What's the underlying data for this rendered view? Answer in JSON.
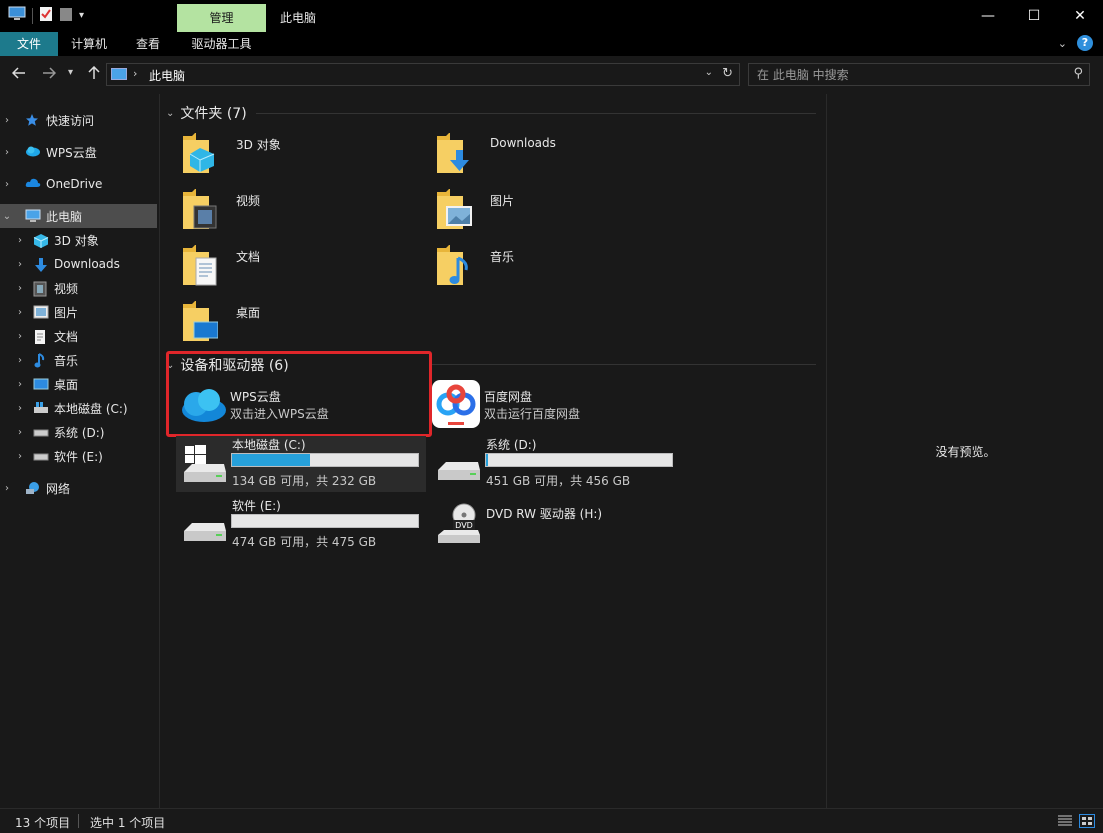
{
  "window": {
    "title": "此电脑",
    "context_tab": "管理",
    "minimize_glyph": "—",
    "maximize_glyph": "☐",
    "close_glyph": "✕"
  },
  "ribbon": {
    "tabs": [
      "文件",
      "计算机",
      "查看",
      "驱动器工具"
    ],
    "expand_glyph": "⌄",
    "help_glyph": "?"
  },
  "address": {
    "path": "此电脑",
    "search_placeholder": "在 此电脑 中搜索"
  },
  "sidebar": {
    "items": [
      {
        "label": "快速访问",
        "icon": "star-icon"
      },
      {
        "label": "WPS云盘",
        "icon": "wps-cloud-icon"
      },
      {
        "label": "OneDrive",
        "icon": "onedrive-cloud-icon"
      },
      {
        "label": "此电脑",
        "icon": "computer-icon",
        "selected": true
      },
      {
        "label": "3D 对象",
        "icon": "cube-icon"
      },
      {
        "label": "Downloads",
        "icon": "download-arrow-icon"
      },
      {
        "label": "视频",
        "icon": "video-icon"
      },
      {
        "label": "图片",
        "icon": "picture-icon"
      },
      {
        "label": "文档",
        "icon": "document-icon"
      },
      {
        "label": "音乐",
        "icon": "music-note-icon"
      },
      {
        "label": "桌面",
        "icon": "desktop-icon"
      },
      {
        "label": "本地磁盘 (C:)",
        "icon": "windows-drive-icon"
      },
      {
        "label": "系统 (D:)",
        "icon": "drive-icon"
      },
      {
        "label": "软件 (E:)",
        "icon": "drive-icon"
      },
      {
        "label": "网络",
        "icon": "network-icon"
      }
    ]
  },
  "folders_section": {
    "title": "文件夹 (7)",
    "items": [
      {
        "label": "3D 对象",
        "icon": "folder-3d-icon"
      },
      {
        "label": "Downloads",
        "icon": "folder-downloads-icon"
      },
      {
        "label": "视频",
        "icon": "folder-video-icon"
      },
      {
        "label": "图片",
        "icon": "folder-pictures-icon"
      },
      {
        "label": "文档",
        "icon": "folder-documents-icon"
      },
      {
        "label": "音乐",
        "icon": "folder-music-icon"
      },
      {
        "label": "桌面",
        "icon": "folder-desktop-icon"
      }
    ]
  },
  "devices_section": {
    "title": "设备和驱动器 (6)",
    "wps": {
      "name": "WPS云盘",
      "desc": "双击进入WPS云盘"
    },
    "baidu": {
      "name": "百度网盘",
      "desc": "双击运行百度网盘"
    },
    "drives": [
      {
        "name": "本地磁盘 (C:)",
        "info": "134 GB 可用，共 232 GB",
        "used_fraction": 0.42
      },
      {
        "name": "系统 (D:)",
        "info": "451 GB 可用，共 456 GB",
        "used_fraction": 0.01
      },
      {
        "name": "软件 (E:)",
        "info": "474 GB 可用，共 475 GB",
        "used_fraction": 0.0
      },
      {
        "name": "DVD RW 驱动器 (H:)",
        "info": ""
      }
    ],
    "dvd_badge": "DVD"
  },
  "preview": {
    "message": "没有预览。"
  },
  "status": {
    "count": "13 个项目",
    "selected": "选中 1 个项目"
  },
  "colors": {
    "accent": "#1d7a8c",
    "context_tab": "#b4e3a1",
    "bar_fill": "#26a0da",
    "highlight_box": "#e0262a"
  }
}
